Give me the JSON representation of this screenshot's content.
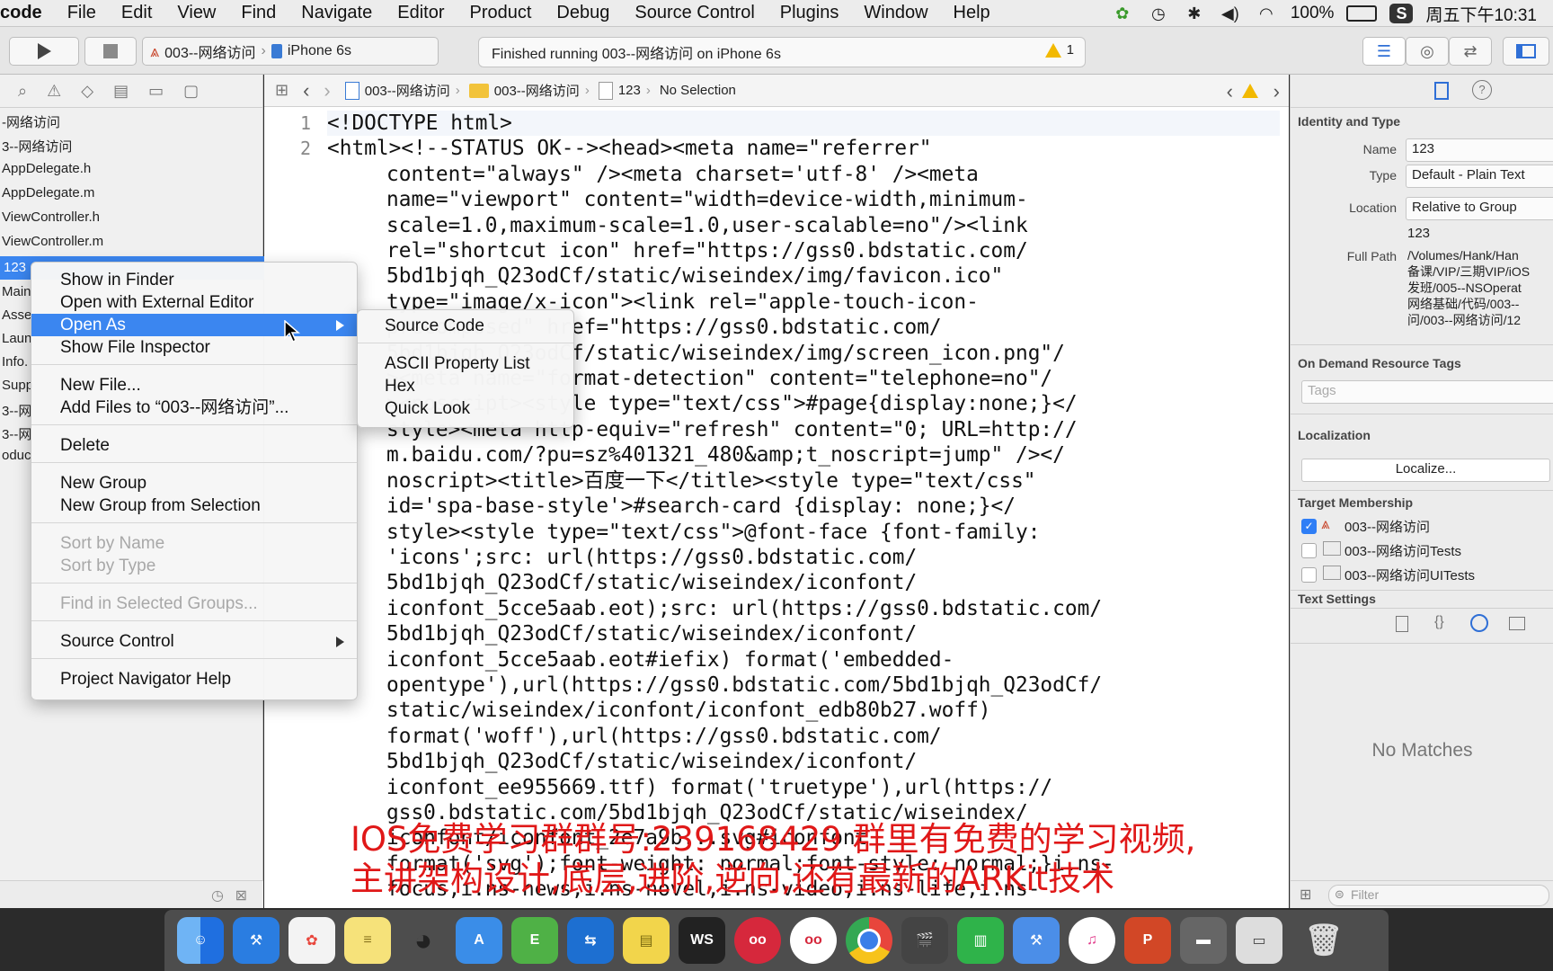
{
  "menubar": {
    "app": "code",
    "items": [
      "File",
      "Edit",
      "View",
      "Find",
      "Navigate",
      "Editor",
      "Product",
      "Debug",
      "Source Control",
      "Plugins",
      "Window",
      "Help"
    ],
    "battery": "100%",
    "clock": "周五下午10:31"
  },
  "toolbar": {
    "scheme_target": "003--网络访问",
    "device": "iPhone 6s",
    "activity_text": "Finished running 003--网络访问 on iPhone 6s",
    "warning_count": "1"
  },
  "navigator": {
    "items": [
      "-网络访问",
      "3--网络访问",
      "AppDelegate.h",
      "AppDelegate.m",
      "ViewController.h",
      "ViewController.m",
      "123",
      "Main",
      "Asse",
      "Laun",
      "Info.",
      "Supp",
      "3--网",
      "3--网",
      "oduc"
    ]
  },
  "jumpbar": {
    "crumb1": "003--网络访问",
    "crumb2": "003--网络访问",
    "crumb3": "123",
    "crumb4": "No Selection"
  },
  "editor": {
    "line_numbers": [
      "1",
      "2"
    ],
    "lines": [
      "<!DOCTYPE html>",
      "<html><!--STATUS OK--><head><meta name=\"referrer\"",
      "content=\"always\" /><meta charset='utf-8' /><meta",
      "name=\"viewport\" content=\"width=device-width,minimum-",
      "scale=1.0,maximum-scale=1.0,user-scalable=no\"/><link",
      "rel=\"shortcut icon\" href=\"https://gss0.bdstatic.com/",
      "5bd1bjqh_Q23odCf/static/wiseindex/img/favicon.ico\"",
      "type=\"image/x-icon\"><link rel=\"apple-touch-icon-",
      "precomposed\" href=\"https://gss0.bdstatic.com/",
      "5bd1bjqh_Q23odCf/static/wiseindex/img/screen_icon.png\"/",
      "><meta name=\"format-detection\" content=\"telephone=no\"/",
      "><noscript><style type=\"text/css\">#page{display:none;}</",
      "style><meta http-equiv=\"refresh\" content=\"0; URL=http://",
      "m.baidu.com/?pu=sz%401321_480&amp;t_noscript=jump\" /></",
      "noscript><title>百度一下</title><style type=\"text/css\"",
      "id='spa-base-style'>#search-card {display: none;}</",
      "style><style type=\"text/css\">@font-face {font-family:",
      "'icons';src: url(https://gss0.bdstatic.com/",
      "5bd1bjqh_Q23odCf/static/wiseindex/iconfont/",
      "iconfont_5cce5aab.eot);src: url(https://gss0.bdstatic.com/",
      "5bd1bjqh_Q23odCf/static/wiseindex/iconfont/",
      "iconfont_5cce5aab.eot#iefix) format('embedded-",
      "opentype'),url(https://gss0.bdstatic.com/5bd1bjqh_Q23odCf/",
      "static/wiseindex/iconfont/iconfont_edb80b27.woff)",
      "format('woff'),url(https://gss0.bdstatic.com/",
      "5bd1bjqh_Q23odCf/static/wiseindex/iconfont/",
      "iconfont_ee955669.ttf) format('truetype'),url(https://",
      "gss0.bdstatic.com/5bd1bjqh_Q23odCf/static/wiseindex/",
      "iconfont/iconfont_2e7a9b...svg#iconfont",
      "format('svg');font-weight: normal;font-style: normal;}i.ns-",
      "focus,i.ns-news,i.ns-novel,i.ns-video,i.ns-life,i.ns-"
    ]
  },
  "context_menu": {
    "items": [
      "Show in Finder",
      "Open with External Editor",
      "Open As",
      "Show File Inspector",
      "New File...",
      "Add Files to “003--网络访问”...",
      "Delete",
      "New Group",
      "New Group from Selection",
      "Sort by Name",
      "Sort by Type",
      "Find in Selected Groups...",
      "Source Control",
      "Project Navigator Help"
    ]
  },
  "submenu": {
    "items": [
      "Source Code",
      "ASCII Property List",
      "Hex",
      "Quick Look"
    ]
  },
  "inspector": {
    "identity_header": "Identity and Type",
    "name_label": "Name",
    "name_value": "123",
    "type_label": "Type",
    "type_value": "Default - Plain Text",
    "location_label": "Location",
    "location_value": "Relative to Group",
    "location_file": "123",
    "fullpath_label": "Full Path",
    "fullpath_lines": [
      "/Volumes/Hank/Han",
      "备课/VIP/三期VIP/iOS",
      "发班/005--NSOperat",
      "网络基础/代码/003--",
      "问/003--网络访问/12"
    ],
    "odr_header": "On Demand Resource Tags",
    "tags_placeholder": "Tags",
    "localization_header": "Localization",
    "localize_button": "Localize...",
    "target_header": "Target Membership",
    "targets": [
      "003--网络访问",
      "003--网络访问Tests",
      "003--网络访问UITests"
    ],
    "text_settings_header": "Text Settings",
    "no_matches": "No Matches",
    "filter_placeholder": "Filter"
  },
  "subtitle": {
    "line1": "IOS免费学习群群号:239168429 群里有免费的学习视频,",
    "line2": "主讲架构设计,底层,进阶,逆向,还有最新的ARKit技术"
  }
}
